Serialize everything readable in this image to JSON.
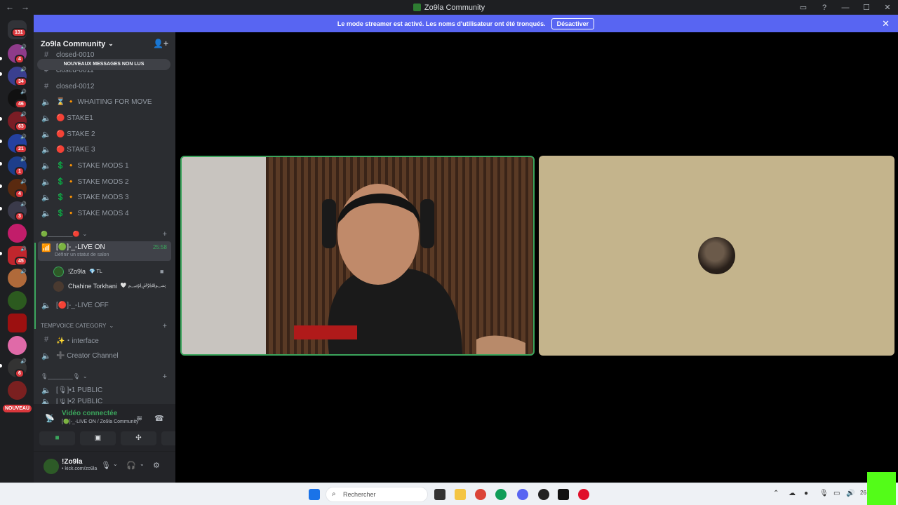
{
  "window": {
    "title": "Zo9la Community",
    "back": "←",
    "forward": "→",
    "minimize": "—",
    "maximize": "☐",
    "close": "✕"
  },
  "banner": {
    "text": "Le mode streamer est activé. Les noms d'utilisateur ont été tronqués.",
    "button": "Désactiver"
  },
  "guilds": {
    "home_badge": "131",
    "badges": [
      "4",
      "34",
      "46",
      "63",
      "21",
      "1",
      "4",
      "3",
      "45",
      "6"
    ],
    "new_label": "NOUVEAU"
  },
  "server": {
    "name": "Zo9la Community",
    "unread_banner": "NOUVEAUX MESSAGES NON LUS"
  },
  "channels": [
    {
      "label": "closed-0010",
      "type": "text"
    },
    {
      "label": "closed-0011",
      "type": "text"
    },
    {
      "label": "closed-0012",
      "type": "text"
    },
    {
      "label": "⌛ 🔸 WHAITING FOR MOVE",
      "type": "voice"
    },
    {
      "label": "🔴 STAKE1",
      "type": "voice"
    },
    {
      "label": "🔴 STAKE 2",
      "type": "voice"
    },
    {
      "label": "🔴 STAKE 3",
      "type": "voice"
    },
    {
      "label": "💲 🔸 STAKE MODS 1",
      "type": "voice"
    },
    {
      "label": "💲 🔸 STAKE MODS 2",
      "type": "voice"
    },
    {
      "label": "💲 🔸 STAKE MODS 3",
      "type": "voice"
    },
    {
      "label": "💲 🔸 STAKE MODS 4",
      "type": "voice"
    }
  ],
  "live_category": {
    "label": "🟢________🔴"
  },
  "active_channel": {
    "label": "[🟢]-_-LIVE ON",
    "time": "25:58",
    "status": "Définir un statut de salon"
  },
  "voice_users": [
    {
      "name": "!Zo9la",
      "tag": "💎 TL"
    },
    {
      "name": "Chahine Torkhani",
      "tag": "🤍 ﷽"
    }
  ],
  "live_off": {
    "label": "[🔴]-_-LIVE OFF"
  },
  "tempvoice": {
    "label": "TEMPVOICE CATEGORY",
    "channels": [
      {
        "label": "✨・interface",
        "type": "text"
      },
      {
        "label": "➕ Creator Channel",
        "type": "voice"
      }
    ]
  },
  "public_category": {
    "label": "🎙________🎙"
  },
  "public_channels": [
    {
      "label": "[🎙]•1 PUBLIC"
    },
    {
      "label": "[🎙]•2 PUBLIC"
    }
  ],
  "voice_panel": {
    "title": "Vidéo connectée",
    "subtitle": "[🟢]-_-LIVE ON / Zo9la Community"
  },
  "user_panel": {
    "name": "!Zo9la",
    "status": "• kick.com/zo9la"
  },
  "taskbar": {
    "search_placeholder": "Rechercher",
    "date": "26"
  },
  "colors": {
    "accent": "#5865f2",
    "green": "#3ba55c",
    "kick": "#53fc18"
  }
}
